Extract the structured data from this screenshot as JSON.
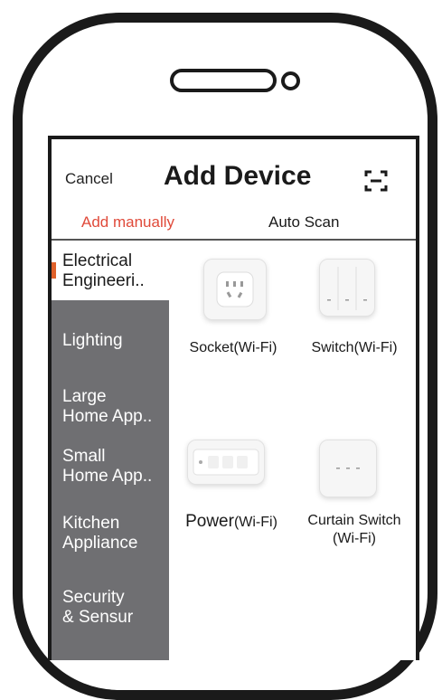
{
  "header": {
    "cancel_label": "Cancel",
    "title": "Add Device",
    "scan_icon": "scan-icon"
  },
  "tabs": {
    "manual_label": "Add manually",
    "auto_label": "Auto Scan",
    "active_color": "#e04a3a"
  },
  "sidebar": {
    "items": [
      {
        "label_line1": "Electrical",
        "label_line2": "Engineeri.."
      },
      {
        "label_line1": "Lighting",
        "label_line2": ""
      },
      {
        "label_line1": "Large",
        "label_line2": "Home App.."
      },
      {
        "label_line1": "Small",
        "label_line2": "Home App.."
      },
      {
        "label_line1": "Kitchen",
        "label_line2": "Appliance"
      },
      {
        "label_line1": "Security",
        "label_line2": "& Sensur"
      }
    ],
    "background": "#6f6f72",
    "marker_color": "#e0612a"
  },
  "devices": [
    {
      "label": "Socket(Wi-Fi)",
      "icon": "socket-icon"
    },
    {
      "label": "Switch(Wi-Fi)",
      "icon": "switch-icon"
    },
    {
      "label_bold": "Power",
      "label_rest": "(Wi-Fi)",
      "icon": "power-strip-icon"
    },
    {
      "label_line1": "Curtain Switch",
      "label_line2": "(Wi-Fi)",
      "icon": "curtain-switch-icon"
    }
  ]
}
